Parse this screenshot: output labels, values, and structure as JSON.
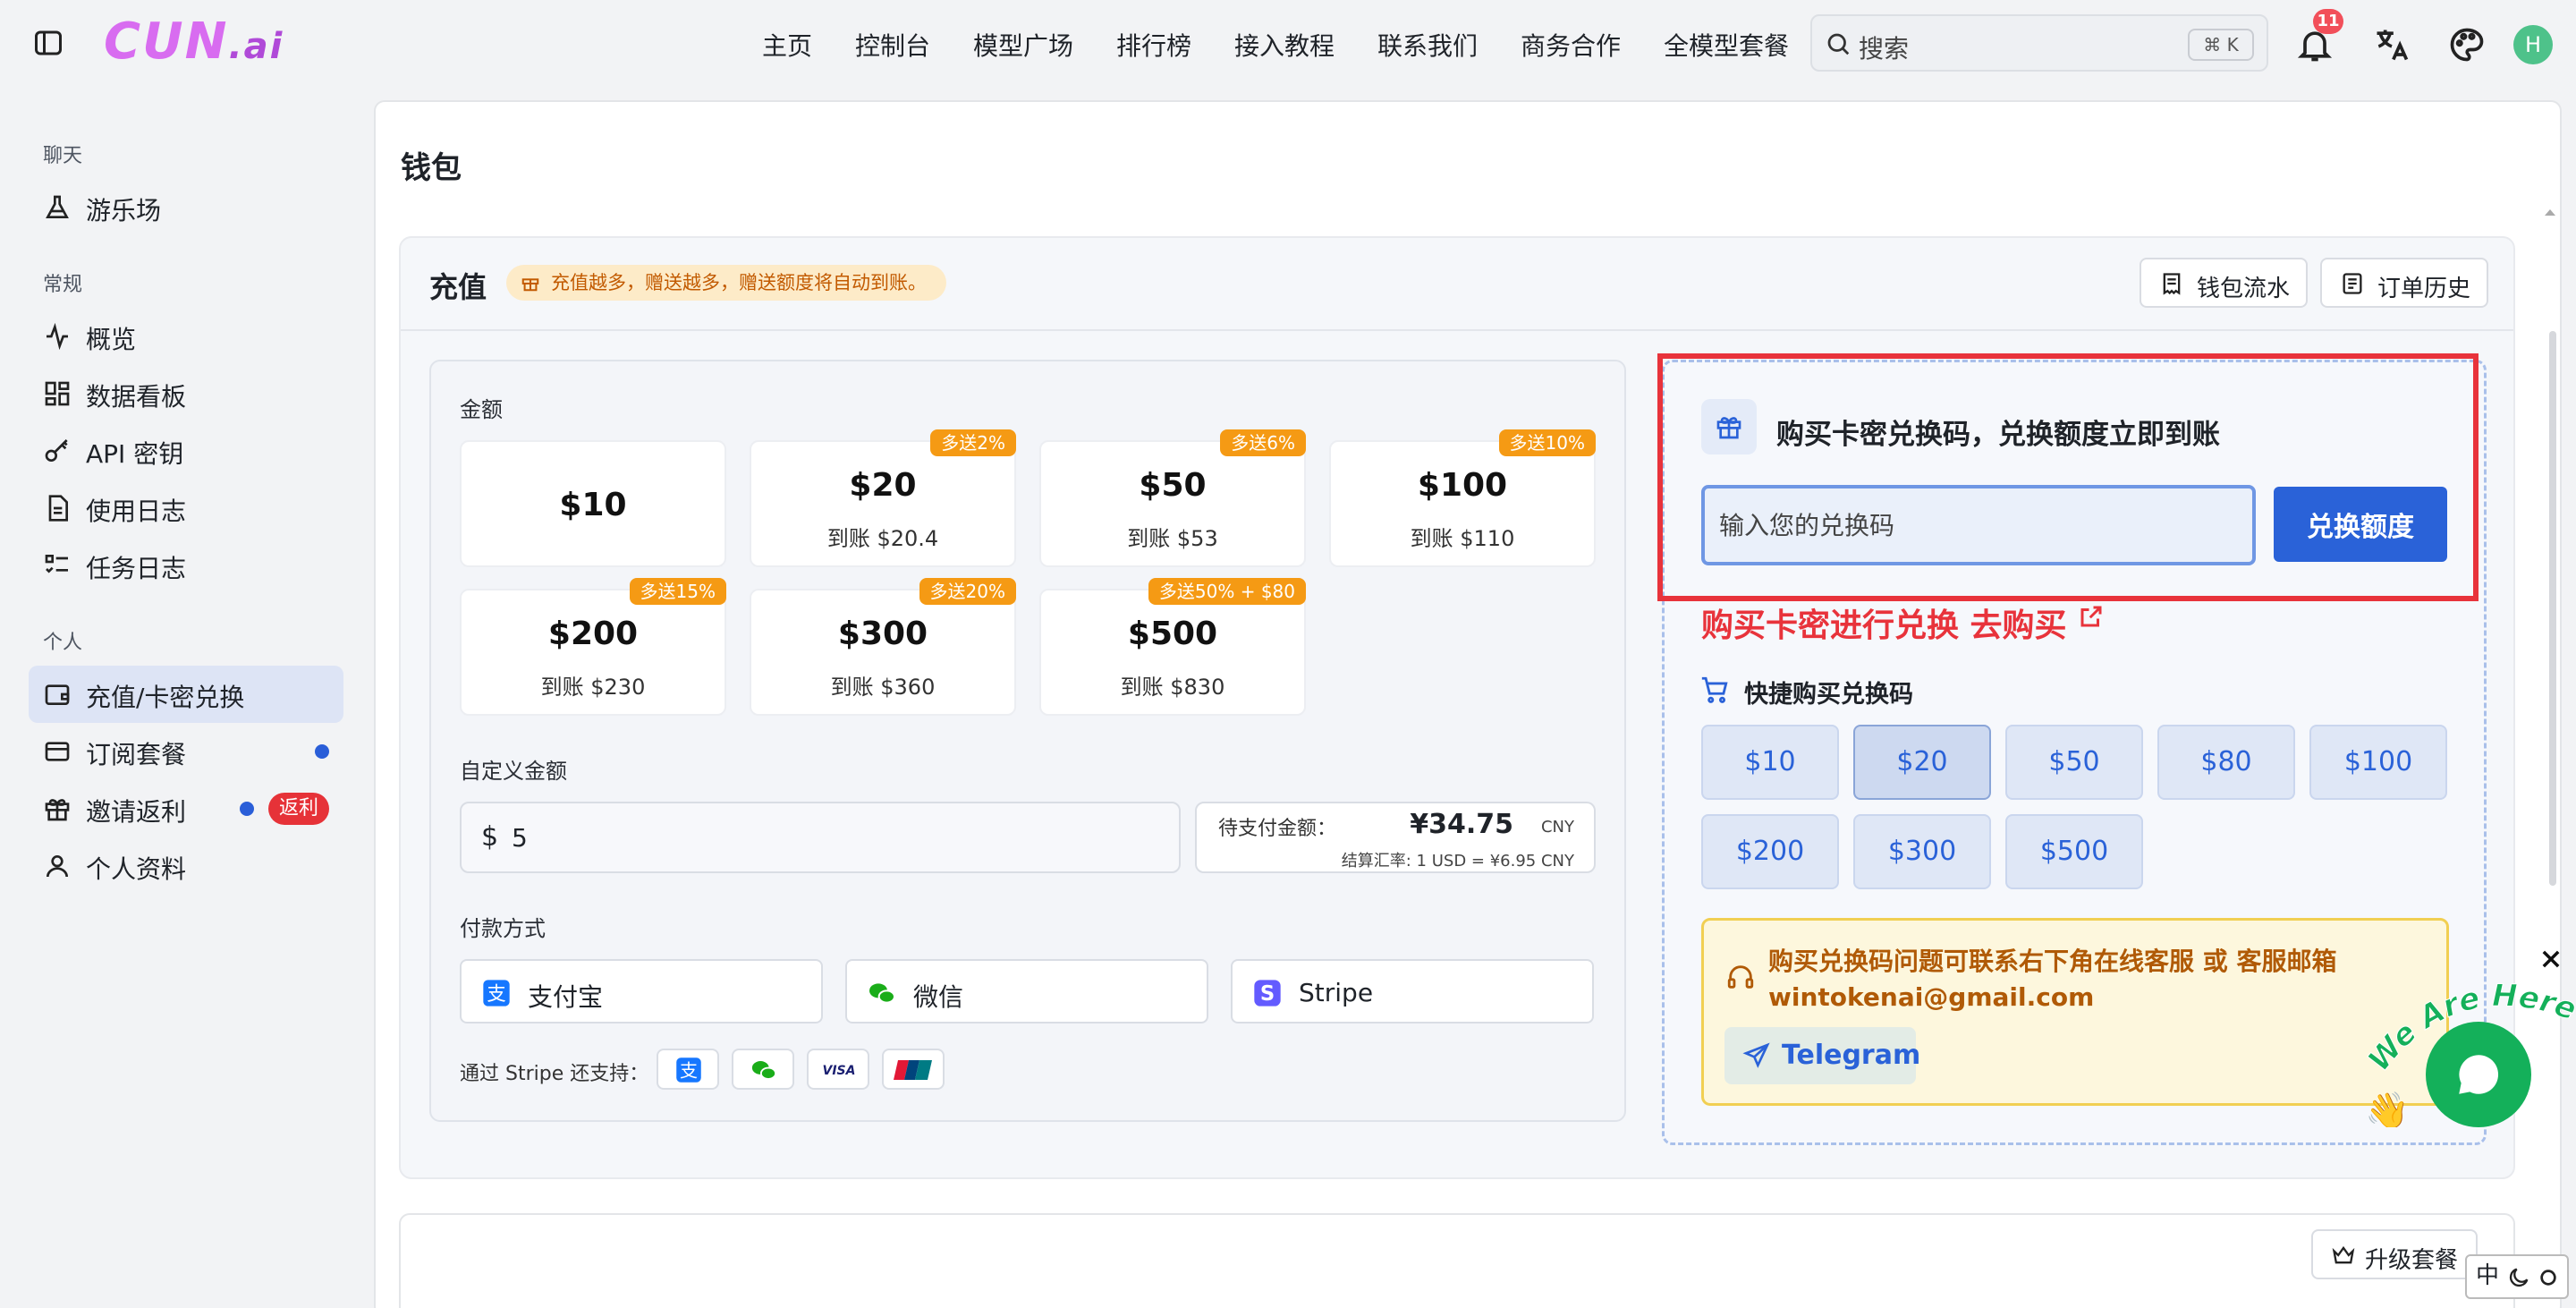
{
  "header": {
    "logo_main": "CUN",
    "logo_suffix": ".ai",
    "nav": [
      "主页",
      "控制台",
      "模型广场",
      "排行榜",
      "接入教程",
      "联系我们",
      "商务合作",
      "全模型套餐"
    ],
    "search_placeholder": "搜索",
    "search_shortcut": "⌘ K",
    "notification_count": "11",
    "avatar_letter": "H"
  },
  "sidebar": {
    "sections": [
      {
        "title": "聊天",
        "items": [
          {
            "label": "游乐场",
            "icon": "flask-icon"
          }
        ]
      },
      {
        "title": "常规",
        "items": [
          {
            "label": "概览",
            "icon": "activity-icon"
          },
          {
            "label": "数据看板",
            "icon": "dashboard-icon"
          },
          {
            "label": "API 密钥",
            "icon": "key-icon"
          },
          {
            "label": "使用日志",
            "icon": "document-icon"
          },
          {
            "label": "任务日志",
            "icon": "task-list-icon"
          }
        ]
      },
      {
        "title": "个人",
        "items": [
          {
            "label": "充值/卡密兑换",
            "icon": "wallet-icon",
            "active": true
          },
          {
            "label": "订阅套餐",
            "icon": "card-icon",
            "dot": true
          },
          {
            "label": "邀请返利",
            "icon": "gift-icon",
            "dot": true,
            "badge": "返利"
          },
          {
            "label": "个人资料",
            "icon": "user-icon"
          }
        ]
      }
    ]
  },
  "page": {
    "title": "钱包",
    "recharge": {
      "title": "充值",
      "promo": "充值越多，赠送越多，赠送额度将自动到账。",
      "wallet_flow_btn": "钱包流水",
      "order_history_btn": "订单历史",
      "amount_label": "金额",
      "amounts": [
        {
          "value": "$10",
          "credit": "",
          "tag": ""
        },
        {
          "value": "$20",
          "credit": "到账 $20.4",
          "tag": "多送2%"
        },
        {
          "value": "$50",
          "credit": "到账 $53",
          "tag": "多送6%"
        },
        {
          "value": "$100",
          "credit": "到账 $110",
          "tag": "多送10%"
        },
        {
          "value": "$200",
          "credit": "到账 $230",
          "tag": "多送15%"
        },
        {
          "value": "$300",
          "credit": "到账 $360",
          "tag": "多送20%"
        },
        {
          "value": "$500",
          "credit": "到账 $830",
          "tag": "多送50% + $80"
        }
      ],
      "custom_label": "自定义金额",
      "custom_currency": "$",
      "custom_value": "5",
      "pay_amount_label": "待支付金额：",
      "pay_amount_value": "¥34.75",
      "pay_amount_unit": "CNY",
      "rate_text": "结算汇率: 1 USD = ¥6.95 CNY",
      "payment_label": "付款方式",
      "payment_methods": [
        "支付宝",
        "微信",
        "Stripe"
      ],
      "stripe_support_label": "通过 Stripe 还支持：",
      "stripe_support_icons": [
        "alipay-icon",
        "wechat-icon",
        "visa-icon",
        "unionpay-icon"
      ]
    },
    "redeem": {
      "title": "购买卡密兑换码，兑换额度立即到账",
      "input_placeholder": "输入您的兑换码",
      "button": "兑换额度",
      "buy_link": "购买卡密进行兑换 去购买",
      "quick_title": "快捷购买兑换码",
      "quick_amounts": [
        "$10",
        "$20",
        "$50",
        "$80",
        "$100",
        "$200",
        "$300",
        "$500"
      ],
      "selected_quick": "$20",
      "notice_line1": "购买兑换码问题可联系右下角在线客服 或 客服邮箱",
      "notice_line2": "wintokenai@gmail.com",
      "telegram_btn": "Telegram"
    },
    "upgrade_btn": "升级套餐"
  },
  "chat_widget": {
    "text": "We Are Here!"
  },
  "ime": {
    "text": "中"
  },
  "colors": {
    "accent": "#2a62d8",
    "highlight_box": "#e8333b",
    "tag": "#f59a14",
    "chat": "#14b05a"
  }
}
